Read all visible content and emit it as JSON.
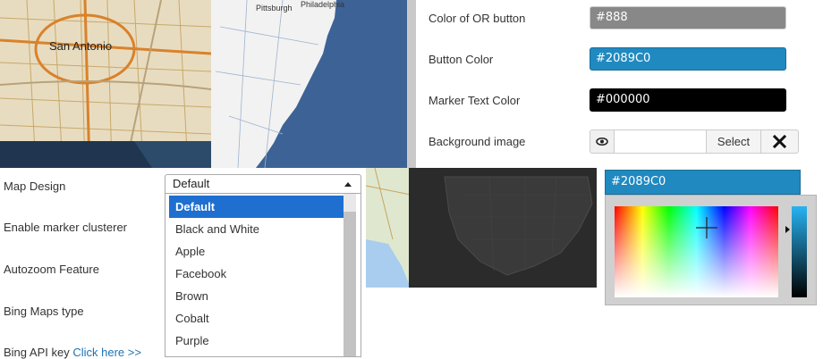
{
  "settings": {
    "or_button_label": "Color of OR button",
    "or_button_value": "#888",
    "button_color_label": "Button Color",
    "button_color_value": "#2089C0",
    "marker_text_label": "Marker Text Color",
    "marker_text_value": "#000000",
    "background_image_label": "Background image",
    "background_image_select": "Select"
  },
  "colors": {
    "or_button": "#888888",
    "button_color": "#2089C0",
    "marker_text": "#000000"
  },
  "map_tiles": {
    "street_city_label": "San Antonio",
    "coast_city_1": "Pittsburgh",
    "coast_city_2": "Philadelphia"
  },
  "form": {
    "map_design_label": "Map Design",
    "map_design_value": "Default",
    "marker_clusterer_label": "Enable marker clusterer",
    "autozoom_label": "Autozoom Feature",
    "bing_type_label": "Bing Maps type",
    "bing_key_label": "Bing API key",
    "bing_key_link": "Click here >>"
  },
  "map_design_options": [
    "Default",
    "Black and White",
    "Apple",
    "Facebook",
    "Brown",
    "Cobalt",
    "Purple"
  ],
  "color_picker": {
    "value": "#2089C0"
  }
}
